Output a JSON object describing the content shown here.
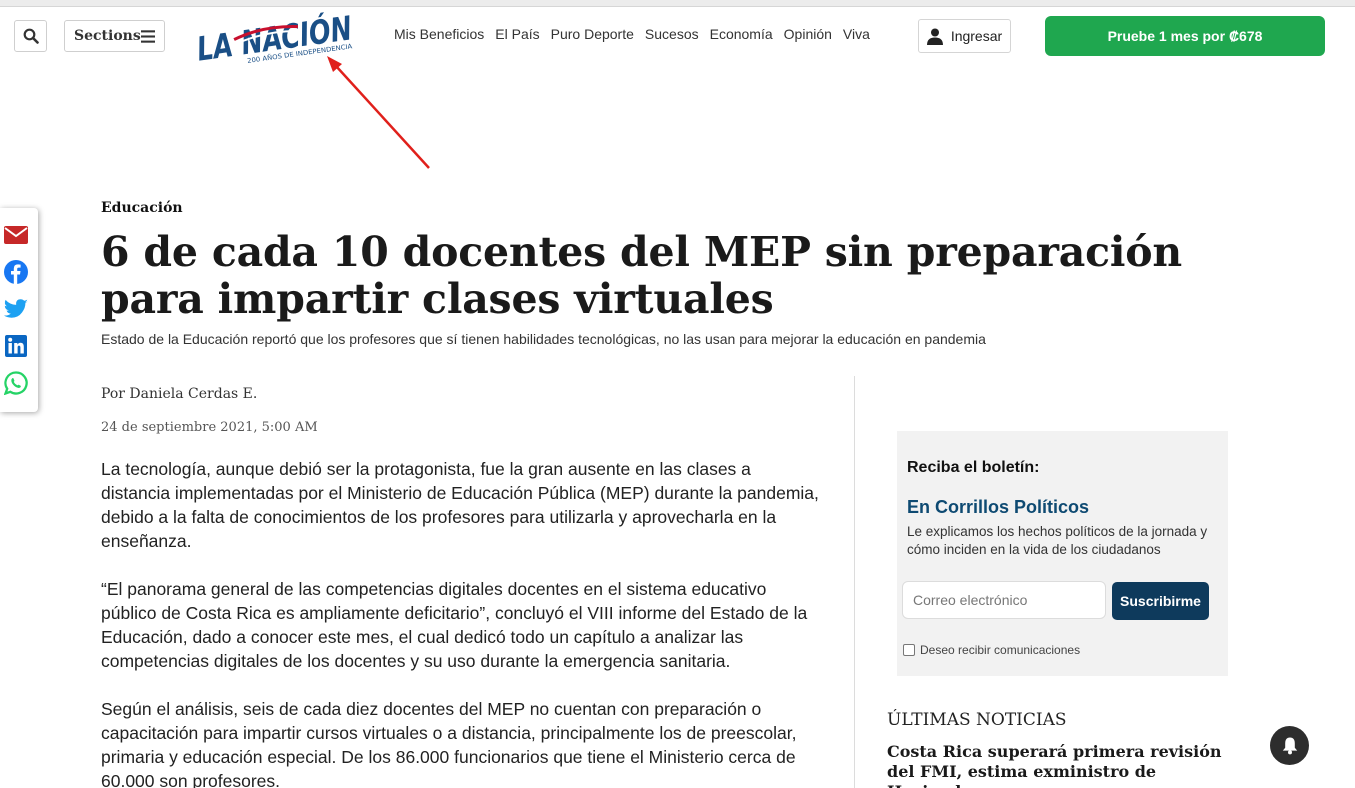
{
  "header": {
    "sections_label": "Sections",
    "logo_text": "LA NACIÓN",
    "logo_subtext": "200 AÑOS DE INDEPENDENCIA",
    "nav": [
      "Mis Beneficios",
      "El País",
      "Puro Deporte",
      "Sucesos",
      "Economía",
      "Opinión",
      "Viva"
    ],
    "login_label": "Ingresar",
    "promo_label": "Pruebe 1 mes por ₡678"
  },
  "share": {
    "icons": [
      "email-icon",
      "facebook-icon",
      "twitter-icon",
      "linkedin-icon",
      "whatsapp-icon"
    ]
  },
  "article": {
    "kicker": "Educación",
    "headline": "6 de cada 10 docentes del MEP sin preparación para impartir clases virtuales",
    "subtitle": "Estado de la Educación reportó que los profesores que sí tienen habilidades tecnológicas, no las usan para mejorar la educación en pandemia",
    "byline": "Por Daniela Cerdas E.",
    "date": "24 de septiembre 2021, 5:00 AM",
    "paragraphs": [
      "La tecnología, aunque debió ser la protagonista, fue la gran ausente en las clases a distancia implementadas por el Ministerio de Educación Pública (MEP) durante la pandemia, debido a la falta de conocimientos de los profesores para utilizarla y aprovecharla en la enseñanza.",
      "“El panorama general de las competencias digitales docentes en el sistema educativo público de Costa Rica es ampliamente deficitario”, concluyó el VIII informe del Estado de la Educación, dado a conocer este mes, el cual dedicó todo un capítulo a analizar las competencias digitales de los docentes y su uso durante la emergencia sanitaria.",
      "Según el análisis, seis de cada diez docentes del MEP no cuentan con preparación o capacitación para impartir cursos virtuales o a distancia, principalmente los de preescolar, primaria y educación especial. De los 86.000 funcionarios que tiene el Ministerio cerca de 60.000 son profesores."
    ]
  },
  "newsletter": {
    "title": "Reciba el boletín:",
    "name": "En Corrillos Políticos",
    "description": "Le explicamos los hechos políticos de la jornada y cómo inciden en la vida de los ciudadanos",
    "email_placeholder": "Correo electrónico",
    "submit_label": "Suscribirme",
    "consent_label": "Deseo recibir comunicaciones"
  },
  "latest": {
    "title": "ÚLTIMAS NOTICIAS",
    "items": [
      "Costa Rica superará primera revisión del FMI, estima exministro de Hacienda"
    ]
  },
  "colors": {
    "promo_green": "#1fa74f",
    "newsletter_blue": "#0e4a72",
    "submit_navy": "#0e3a5c",
    "annotation_red": "#e0201b",
    "logo_blue": "#1a4f86",
    "logo_red": "#c8102e"
  }
}
